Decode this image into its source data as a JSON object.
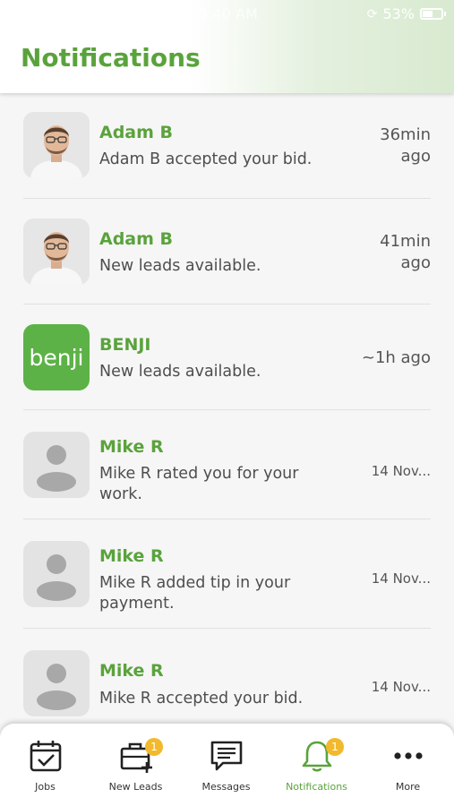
{
  "status_bar": {
    "time": "9:40 AM",
    "battery": "53%"
  },
  "header": {
    "title": "Notifications"
  },
  "notifications": [
    {
      "name": "Adam B",
      "message": "Adam B accepted your bid.",
      "time_line1": "36min",
      "time_line2": "ago",
      "avatar": "photo"
    },
    {
      "name": "Adam B",
      "message": "New leads available.",
      "time_line1": "41min",
      "time_line2": "ago",
      "avatar": "photo"
    },
    {
      "name": "BENJI",
      "message": "New leads available.",
      "time_line1": "~1h ago",
      "time_line2": "",
      "avatar": "benji",
      "avatar_text": "benji"
    },
    {
      "name": "Mike R",
      "message": "Mike R rated you for your work.",
      "time_line1": "14 Nov...",
      "time_line2": "",
      "avatar": "placeholder"
    },
    {
      "name": "Mike R",
      "message": "Mike R added tip in your payment.",
      "time_line1": "14 Nov...",
      "time_line2": "",
      "avatar": "placeholder"
    },
    {
      "name": "Mike R",
      "message": "Mike R accepted your bid.",
      "time_line1": "14 Nov...",
      "time_line2": "",
      "avatar": "placeholder"
    }
  ],
  "tabbar": {
    "tabs": [
      {
        "label": "Jobs",
        "icon": "calendar-check-icon"
      },
      {
        "label": "New Leads",
        "icon": "briefcase-plus-icon",
        "badge": "1"
      },
      {
        "label": "Messages",
        "icon": "message-icon"
      },
      {
        "label": "Notifications",
        "icon": "bell-icon",
        "badge": "1",
        "active": true
      },
      {
        "label": "More",
        "icon": "more-icon"
      }
    ]
  },
  "colors": {
    "accent": "#5aa33c",
    "badge": "#f2b92d",
    "benji_bg": "#5cb246"
  }
}
